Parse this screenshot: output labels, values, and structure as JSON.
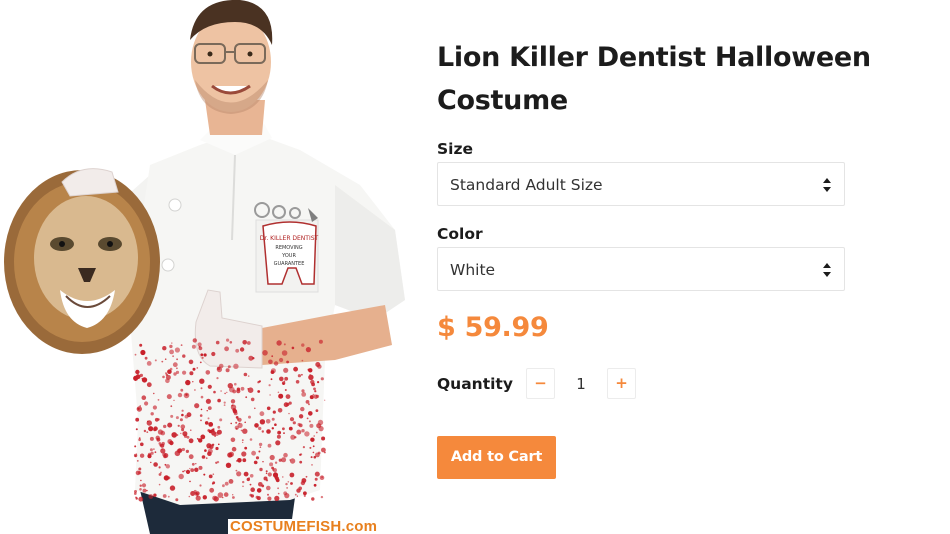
{
  "product": {
    "title": "Lion Killer Dentist Halloween Costume",
    "watermark": "COSTUMEFISH.com",
    "pocket_sign": [
      "Dr. KILLER DENTIST",
      "REMOVING",
      "YOUR",
      "GUARANTEE"
    ]
  },
  "options": {
    "size": {
      "label": "Size",
      "value": "Standard Adult Size"
    },
    "color": {
      "label": "Color",
      "value": "White"
    }
  },
  "price": "$ 59.99",
  "quantity": {
    "label": "Quantity",
    "decrement": "−",
    "value": "1",
    "increment": "+"
  },
  "cart": {
    "button_label": "Add to Cart"
  },
  "colors": {
    "accent": "#f5893c",
    "text": "#1c1c1c",
    "border": "#e4e4e4",
    "blood": "#c8202a"
  },
  "icons": {
    "select_arrows": "sort-arrows-icon"
  }
}
